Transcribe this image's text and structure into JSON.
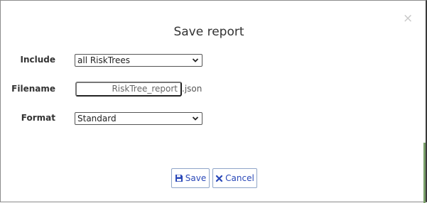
{
  "dialog": {
    "title": "Save report",
    "close_glyph": "×"
  },
  "form": {
    "include": {
      "label": "Include",
      "selected": "all RiskTrees"
    },
    "filename": {
      "label": "Filename",
      "value": "RiskTree_report",
      "extension": ".json"
    },
    "format": {
      "label": "Format",
      "selected": "Standard"
    }
  },
  "buttons": {
    "save": {
      "label": "Save",
      "icon": "floppy-disk-icon"
    },
    "cancel": {
      "label": "Cancel",
      "icon": "x-icon"
    }
  },
  "colors": {
    "button_text": "#2a48b8",
    "button_border": "#8fa5c8"
  }
}
